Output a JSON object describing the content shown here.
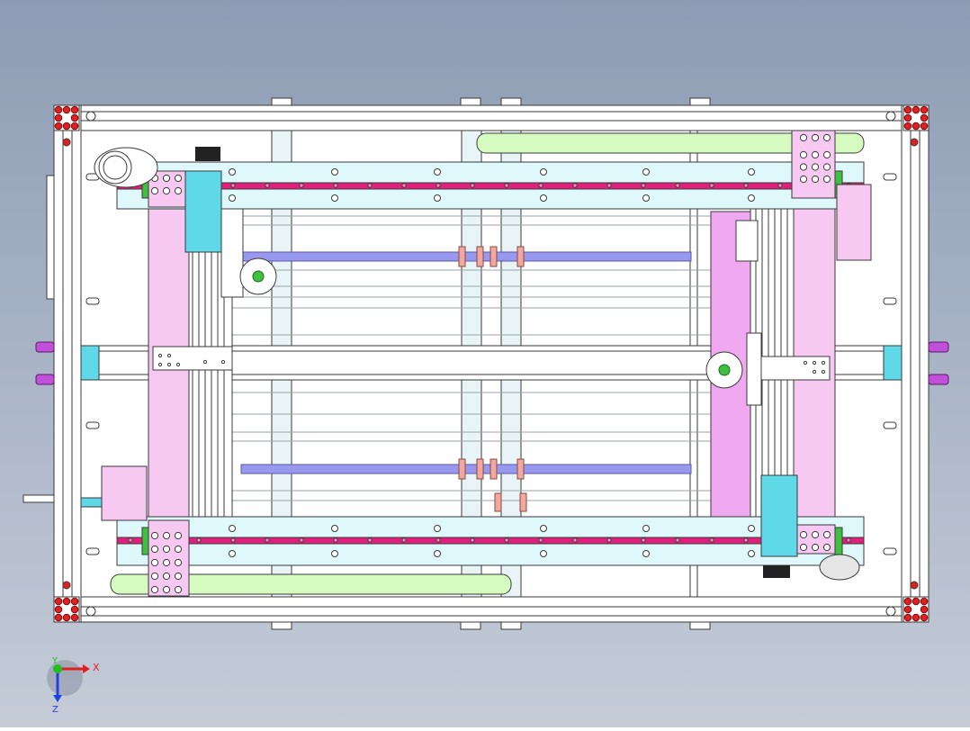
{
  "viewport": {
    "background_top": "#8d9cb4",
    "background_bottom": "#c5ccd8"
  },
  "triad": {
    "x_label": "X",
    "y_label": "Y",
    "z_label": "Z",
    "x_color": "#e02020",
    "y_color": "#20c020",
    "z_color": "#2040e0"
  },
  "colors": {
    "frame": "#ffffff",
    "line": "#3a3a3a",
    "corner_block": "#e02020",
    "rail_cyan": "#dff8fb",
    "rail_stripe": "#e0207a",
    "belt_green": "#d6fbc0",
    "plate_pink": "#f6c8f2",
    "plate_magenta": "#f0a8f0",
    "motor_teal": "#5fd8e8",
    "rod_purple": "#9898ee",
    "handle_purple": "#c050d8",
    "collar_salmon": "#f0a8a0",
    "bearing_green": "#40c040",
    "guide_light": "#e8f4f6"
  }
}
